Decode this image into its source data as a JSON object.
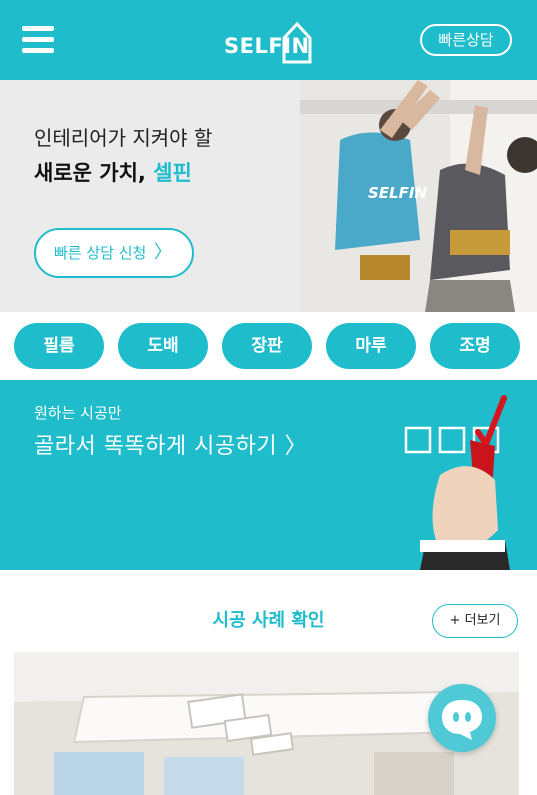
{
  "header": {
    "logo_text": "SELFIN",
    "quick_consult_label": "빠른상담",
    "menu_icon": "hamburger-menu-icon"
  },
  "hero": {
    "line1": "인테리어가 지켜야 할",
    "line2_main": "새로운 가치, ",
    "line2_accent": "셀핀",
    "cta_label": "빠른 상담 신청",
    "shirt_text": "SELFIN"
  },
  "categories": [
    "필름",
    "도배",
    "장판",
    "마루",
    "조명"
  ],
  "banner": {
    "small_text": "원하는 시공만",
    "big_text": "골라서 똑똑하게 시공하기 〉"
  },
  "cases": {
    "title": "시공 사례 확인",
    "more_label": "+ 더보기"
  },
  "colors": {
    "brand": "#1fbccb",
    "white": "#ffffff"
  }
}
